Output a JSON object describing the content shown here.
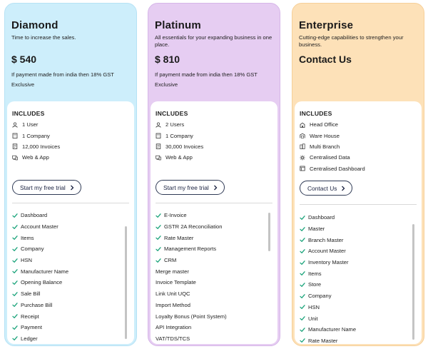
{
  "plans": [
    {
      "key": "diamond",
      "title": "Diamond",
      "description": "Time to increase the sales.",
      "price": "$ 540",
      "note": "If payment made from india then 18% GST Exclusive",
      "includes_heading": "INCLUDES",
      "includes": [
        {
          "icon": "user-icon",
          "label": "1 User"
        },
        {
          "icon": "building-icon",
          "label": "1 Company"
        },
        {
          "icon": "invoice-icon",
          "label": "12,000 Invoices"
        },
        {
          "icon": "web-app-icon",
          "label": "Web & App"
        }
      ],
      "cta_label": "Start my free trial",
      "features": [
        "Dashboard",
        "Account Master",
        "Items",
        "Company",
        "HSN",
        "Manufacturer Name",
        "Opening Balance",
        "Sale Bill",
        "Purchase Bill",
        "Receipt",
        "Payment",
        "Ledger"
      ]
    },
    {
      "key": "platinum",
      "title": "Platinum",
      "description": "All essentials for your expanding business in one place.",
      "price": "$ 810",
      "note": "If payment made from india then 18% GST Exclusive",
      "includes_heading": "INCLUDES",
      "includes": [
        {
          "icon": "user-icon",
          "label": "2 Users"
        },
        {
          "icon": "building-icon",
          "label": "1 Company"
        },
        {
          "icon": "invoice-icon",
          "label": "30,000 Invoices"
        },
        {
          "icon": "web-app-icon",
          "label": "Web & App"
        }
      ],
      "cta_label": "Start my free trial",
      "features": [
        "E-Invoice",
        "GSTR 2A Reconciliation",
        "Rate Master",
        "Management Reports",
        "CRM",
        "Merge master",
        "Invoice Template",
        "Link Unit UQC",
        "Import Method",
        "Loyalty Bonus (Point System)",
        "API Integration",
        "VAT/TDS/TCS"
      ],
      "checked_count": 5
    },
    {
      "key": "enterprise",
      "title": "Enterprise",
      "description": "Cutting-edge capabilities to strengthen your business.",
      "price": "Contact Us",
      "note": "",
      "includes_heading": "INCLUDES",
      "includes": [
        {
          "icon": "head-office-icon",
          "label": "Head Office"
        },
        {
          "icon": "warehouse-icon",
          "label": "Ware House"
        },
        {
          "icon": "multi-branch-icon",
          "label": "Multi Branch"
        },
        {
          "icon": "centralised-data-icon",
          "label": "Centralised Data"
        },
        {
          "icon": "dashboard-icon",
          "label": "Centralised Dashboard"
        }
      ],
      "cta_label": "Contact Us",
      "features": [
        "Dashboard",
        "Master",
        "Branch Master",
        "Account Master",
        "Inventory Master",
        "Items",
        "Store",
        "Company",
        "HSN",
        "Unit",
        "Manufacturer Name",
        "Rate Master"
      ]
    }
  ],
  "colors": {
    "diamond_bg": "#cdeefb",
    "platinum_bg": "#e6cdf2",
    "enterprise_bg": "#fde1b8",
    "check": "#1aa37a",
    "cta_border": "#2f3a55"
  }
}
